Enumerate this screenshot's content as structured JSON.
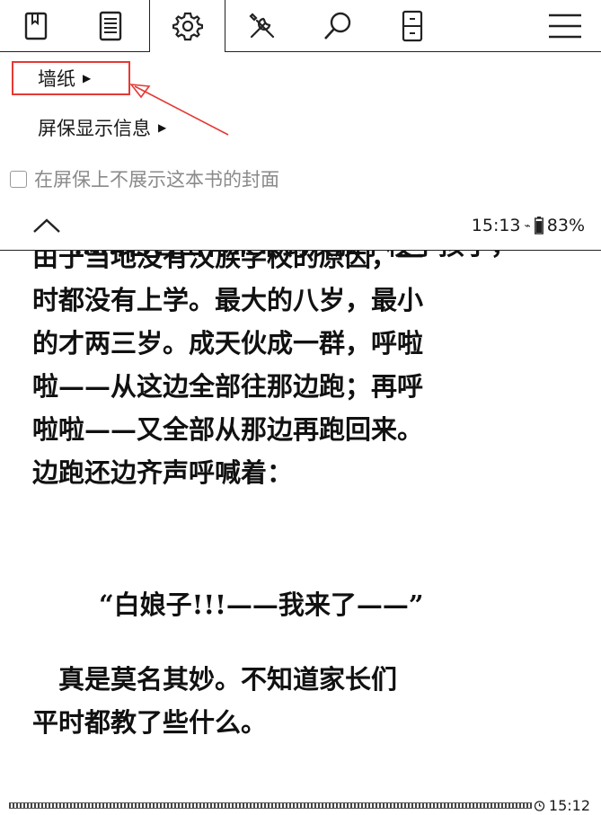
{
  "toolbar": {
    "icons": [
      "bookmark-icon",
      "toc-icon",
      "settings-icon",
      "tools-icon",
      "search-icon",
      "page-layout-icon",
      "menu-icon"
    ],
    "active": "settings-icon"
  },
  "settings_panel": {
    "wallpaper_label": "墙纸",
    "screensaver_info_label": "屏保显示信息",
    "hide_cover_label": "在屏保上不展示这本书的封面",
    "hide_cover_checked": false,
    "highlight_color": "#e53935"
  },
  "status_bar": {
    "time": "15:13",
    "battery": "83%"
  },
  "reader": {
    "partial_line": "……各自由有来来到汉族学校了孩子，",
    "paragraph1": [
      "由于当地没有汉族学校的原因，一",
      "时都没有上学。最大的八岁，最小",
      "的才两三岁。成天伙成一群，呼啦",
      "啦——从这边全部往那边跑；再呼",
      "啦啦——又全部从那边再跑回来。",
      "边跑还边齐声呼喊着："
    ],
    "quote": "“白娘子!!!——我来了——”",
    "paragraph2": [
      "　真是莫名其妙。不知道家长们",
      "平时都教了些什么。"
    ]
  },
  "footer": {
    "time_left": "15:12"
  }
}
